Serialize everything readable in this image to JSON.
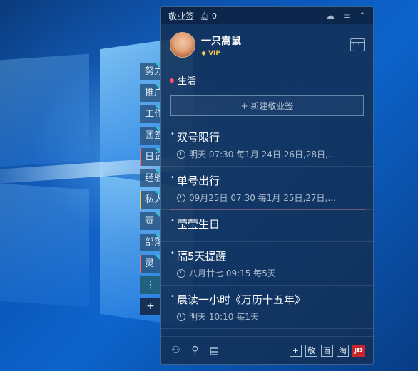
{
  "app": {
    "title": "敬业签",
    "notification_count": "0",
    "icons": [
      "bell-icon",
      "cloud-sync-icon",
      "menu-icon",
      "collapse-icon"
    ]
  },
  "profile": {
    "username": "一只嵩鼠",
    "badge": "VIP",
    "calendar_icon": "calendar-icon"
  },
  "side_tabs": [
    {
      "label": "努力"
    },
    {
      "label": "推广"
    },
    {
      "label": "工作"
    },
    {
      "label": "团签"
    },
    {
      "label": "日记"
    },
    {
      "label": "经验"
    },
    {
      "label": "私人"
    },
    {
      "label": "赛"
    },
    {
      "label": "部落"
    },
    {
      "label": "灵"
    }
  ],
  "side_more": "⋮",
  "side_add": "+",
  "category": {
    "name": "生活",
    "color": "#ff4f6d"
  },
  "new_note_button": "+ 新建敬业签",
  "items": [
    {
      "title": "双号限行",
      "subtitle": "明天 07:30 每1月 24日,26日,28日,..."
    },
    {
      "title": "单号出行",
      "subtitle": "09月25日 07:30 每1月 25日,27日,..."
    },
    {
      "title": "莹莹生日",
      "subtitle": ""
    },
    {
      "title": "隔5天提醒",
      "subtitle": "八月廿七 09:15 每5天"
    },
    {
      "title": "晨读一小时《万历十五年》",
      "subtitle": "明天 10:10 每1天"
    }
  ],
  "bottom_bar": {
    "left_icons": [
      "user-group-icon",
      "search-icon",
      "note-list-icon"
    ],
    "right_buttons": [
      "+",
      "敬",
      "百",
      "淘",
      "JD"
    ]
  }
}
